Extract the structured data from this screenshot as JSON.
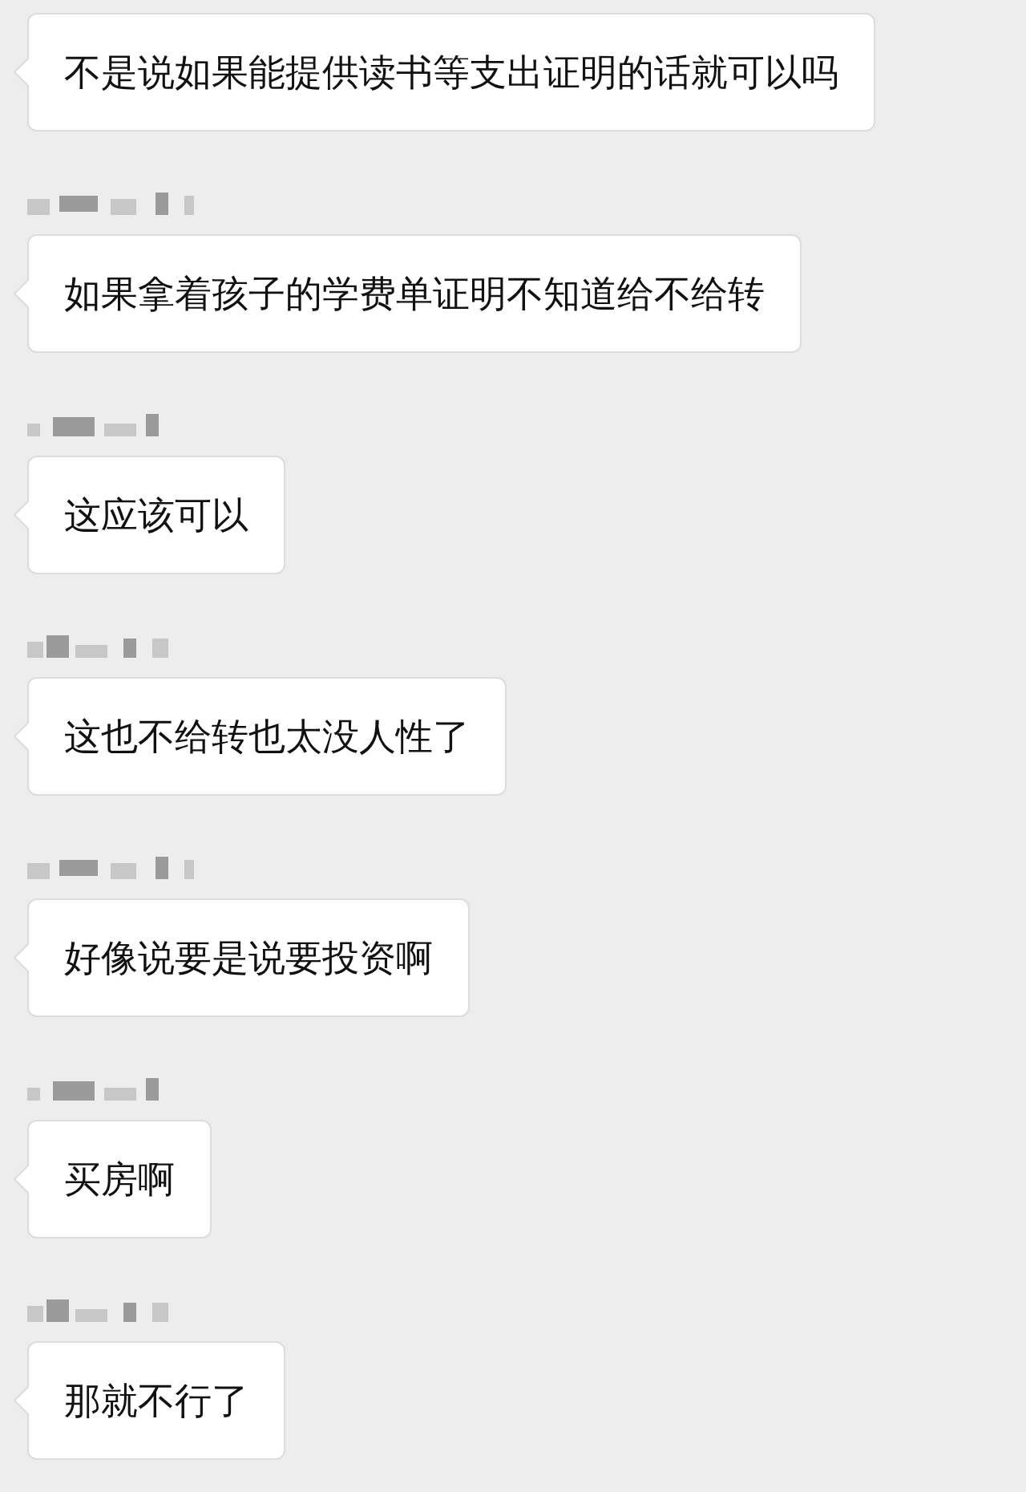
{
  "messages": [
    {
      "text": "不是说如果能提供读书等支出证明的话就可以吗",
      "name_hidden": false
    },
    {
      "text": "如果拿着孩子的学费单证明不知道给不给转",
      "name_hidden": true
    },
    {
      "text": "这应该可以",
      "name_hidden": true
    },
    {
      "text": "这也不给转也太没人性了",
      "name_hidden": true
    },
    {
      "text": "好像说要是说要投资啊",
      "name_hidden": true
    },
    {
      "text": "买房啊",
      "name_hidden": true
    },
    {
      "text": "那就不行了",
      "name_hidden": true
    }
  ]
}
